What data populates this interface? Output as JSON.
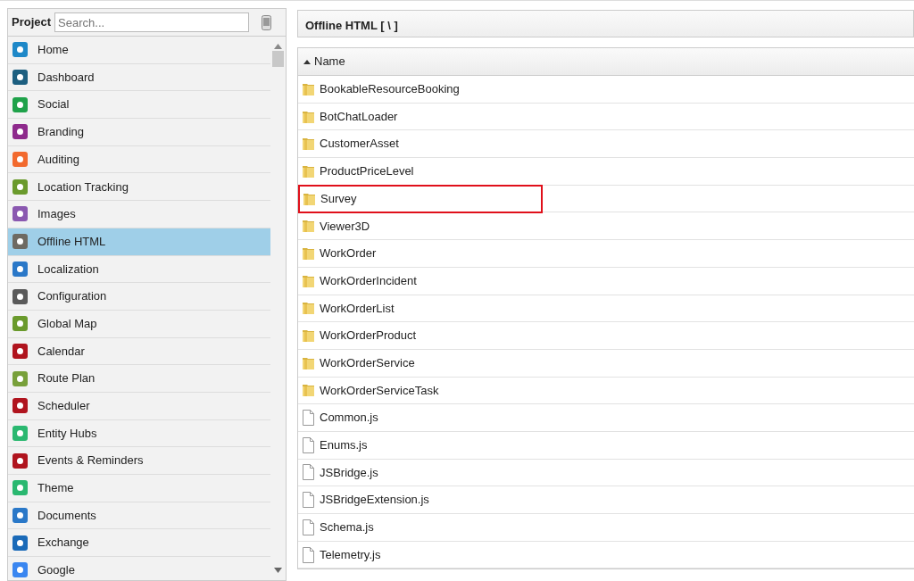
{
  "sidebar": {
    "title": "Project",
    "search": {
      "placeholder": "Search..."
    },
    "items": [
      {
        "label": "Home",
        "color": "#1e88c8",
        "selected": false
      },
      {
        "label": "Dashboard",
        "color": "#1d5f80",
        "selected": false
      },
      {
        "label": "Social",
        "color": "#1fa24a",
        "selected": false
      },
      {
        "label": "Branding",
        "color": "#8e2a8c",
        "selected": false
      },
      {
        "label": "Auditing",
        "color": "#f26a2e",
        "selected": false
      },
      {
        "label": "Location Tracking",
        "color": "#6a9a2c",
        "selected": false
      },
      {
        "label": "Images",
        "color": "#8a58b0",
        "selected": false
      },
      {
        "label": "Offline HTML",
        "color": "#6e6a62",
        "selected": true
      },
      {
        "label": "Localization",
        "color": "#2a78c8",
        "selected": false
      },
      {
        "label": "Configuration",
        "color": "#5a5a5a",
        "selected": false
      },
      {
        "label": "Global Map",
        "color": "#6a9a2c",
        "selected": false
      },
      {
        "label": "Calendar",
        "color": "#b0141e",
        "selected": false
      },
      {
        "label": "Route Plan",
        "color": "#78a03a",
        "selected": false
      },
      {
        "label": "Scheduler",
        "color": "#b0141e",
        "selected": false
      },
      {
        "label": "Entity Hubs",
        "color": "#2ab870",
        "selected": false
      },
      {
        "label": "Events & Reminders",
        "color": "#b0141e",
        "selected": false
      },
      {
        "label": "Theme",
        "color": "#2ab870",
        "selected": false
      },
      {
        "label": "Documents",
        "color": "#2a78c8",
        "selected": false
      },
      {
        "label": "Exchange",
        "color": "#1a6ab8",
        "selected": false
      },
      {
        "label": "Google",
        "color": "#3a86f0",
        "selected": false
      }
    ]
  },
  "panel": {
    "title": "Offline HTML [ \\ ]",
    "table": {
      "columns": [
        {
          "label": "Name",
          "sorted": true
        }
      ],
      "rows": [
        {
          "kind": "folder",
          "name": "BookableResourceBooking",
          "highlighted": false
        },
        {
          "kind": "folder",
          "name": "BotChatLoader",
          "highlighted": false
        },
        {
          "kind": "folder",
          "name": "CustomerAsset",
          "highlighted": false
        },
        {
          "kind": "folder",
          "name": "ProductPriceLevel",
          "highlighted": false
        },
        {
          "kind": "folder",
          "name": "Survey",
          "highlighted": true
        },
        {
          "kind": "folder",
          "name": "Viewer3D",
          "highlighted": false
        },
        {
          "kind": "folder",
          "name": "WorkOrder",
          "highlighted": false
        },
        {
          "kind": "folder",
          "name": "WorkOrderIncident",
          "highlighted": false
        },
        {
          "kind": "folder",
          "name": "WorkOrderList",
          "highlighted": false
        },
        {
          "kind": "folder",
          "name": "WorkOrderProduct",
          "highlighted": false
        },
        {
          "kind": "folder",
          "name": "WorkOrderService",
          "highlighted": false
        },
        {
          "kind": "folder",
          "name": "WorkOrderServiceTask",
          "highlighted": false
        },
        {
          "kind": "file",
          "name": "Common.js",
          "highlighted": false
        },
        {
          "kind": "file",
          "name": "Enums.js",
          "highlighted": false
        },
        {
          "kind": "file",
          "name": "JSBridge.js",
          "highlighted": false
        },
        {
          "kind": "file",
          "name": "JSBridgeExtension.js",
          "highlighted": false
        },
        {
          "kind": "file",
          "name": "Schema.js",
          "highlighted": false
        },
        {
          "kind": "file",
          "name": "Telemetry.js",
          "highlighted": false
        }
      ]
    }
  }
}
